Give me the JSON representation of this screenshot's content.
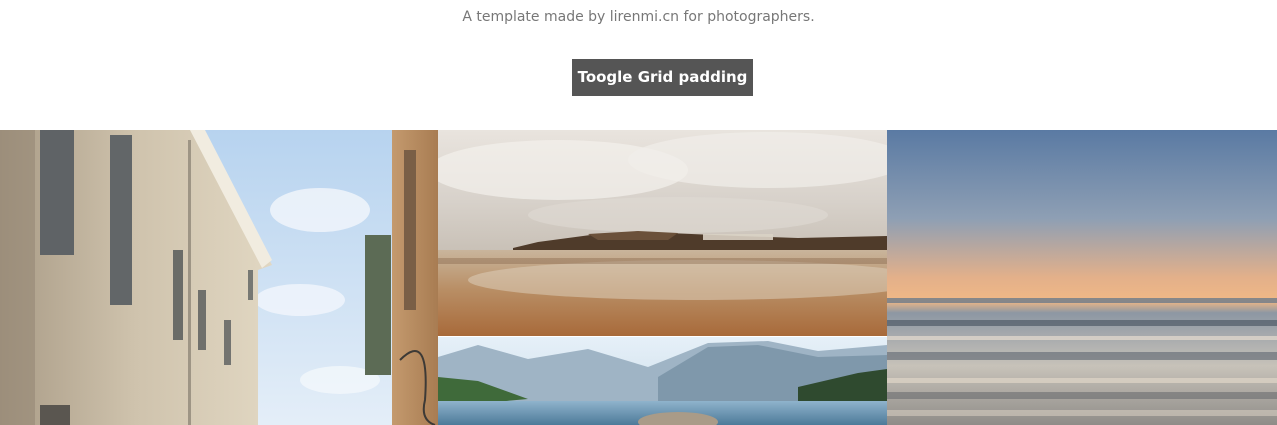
{
  "header": {
    "tagline": "A template made by lirenmi.cn for photographers."
  },
  "toolbar": {
    "toggle_label": "Toogle Grid padding"
  },
  "colors": {
    "button_bg": "#555555",
    "button_text": "#ffffff",
    "tagline_text": "#777777",
    "page_bg": "#ffffff"
  },
  "gallery": {
    "photos": [
      {
        "subject": "street-building-photo"
      },
      {
        "subject": "beach-coast-photo"
      },
      {
        "subject": "mountain-lake-photo"
      },
      {
        "subject": "sunset-sea-photo"
      }
    ]
  }
}
